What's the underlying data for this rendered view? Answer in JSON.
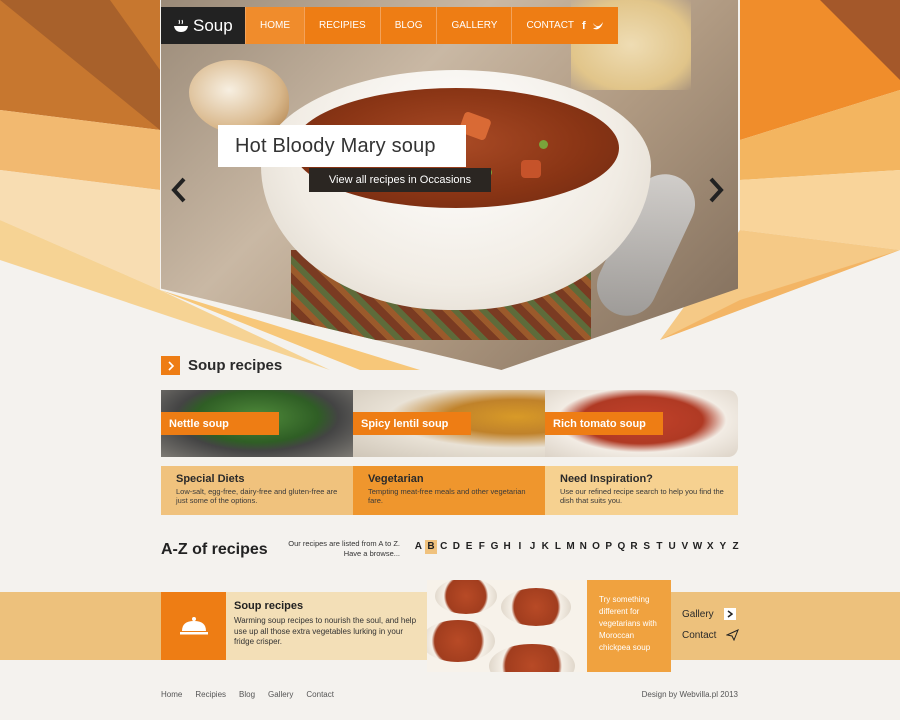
{
  "nav": {
    "logo": "Soup",
    "items": [
      {
        "label": "HOME",
        "active": true
      },
      {
        "label": "RECIPIES",
        "active": false
      },
      {
        "label": "BLOG",
        "active": false
      },
      {
        "label": "GALLERY",
        "active": false
      },
      {
        "label": "CONTACT",
        "active": false
      }
    ],
    "social": [
      "f",
      "twitter-bird"
    ]
  },
  "hero": {
    "title": "Hot Bloody Mary soup",
    "link": "View all recipes in Occasions"
  },
  "section": {
    "title": "Soup recipes"
  },
  "cards": [
    {
      "label": "Nettle soup"
    },
    {
      "label": "Spicy lentil soup"
    },
    {
      "label": "Rich tomato soup"
    }
  ],
  "infos": [
    {
      "title": "Special Diets",
      "text": "Low-salt, egg-free, dairy-free and gluten-free are just some of the options."
    },
    {
      "title": "Vegetarian",
      "text": "Tempting meat-free meals and other vegetarian fare."
    },
    {
      "title": "Need Inspiration?",
      "text": "Use our refined recipe search to help you find the dish that suits you."
    }
  ],
  "az": {
    "title": "A-Z of recipes",
    "note_line1": "Our recipes are listed from A to Z.",
    "note_line2": "Have a browse...",
    "letters": [
      "A",
      "B",
      "C",
      "D",
      "E",
      "F",
      "G",
      "H",
      "I",
      "J",
      "K",
      "L",
      "M",
      "N",
      "O",
      "P",
      "Q",
      "R",
      "S",
      "T",
      "U",
      "V",
      "W",
      "X",
      "Y",
      "Z"
    ],
    "selected": "B"
  },
  "band": {
    "title": "Soup recipes",
    "text": "Warming soup recipes to nourish the soul, and help use up all those extra vegetables lurking in your fridge crisper.",
    "cta": "Try something different for vegetarians with Moroccan chickpea soup",
    "links": [
      {
        "label": "Gallery"
      },
      {
        "label": "Contact"
      }
    ]
  },
  "footer": {
    "links": [
      "Home",
      "Recipies",
      "Blog",
      "Gallery",
      "Contact"
    ],
    "credit": "Design by Webvilla.pl 2013"
  },
  "colors": {
    "accent": "#ee7d14",
    "dark": "#222222",
    "tan": "#edc17c"
  }
}
